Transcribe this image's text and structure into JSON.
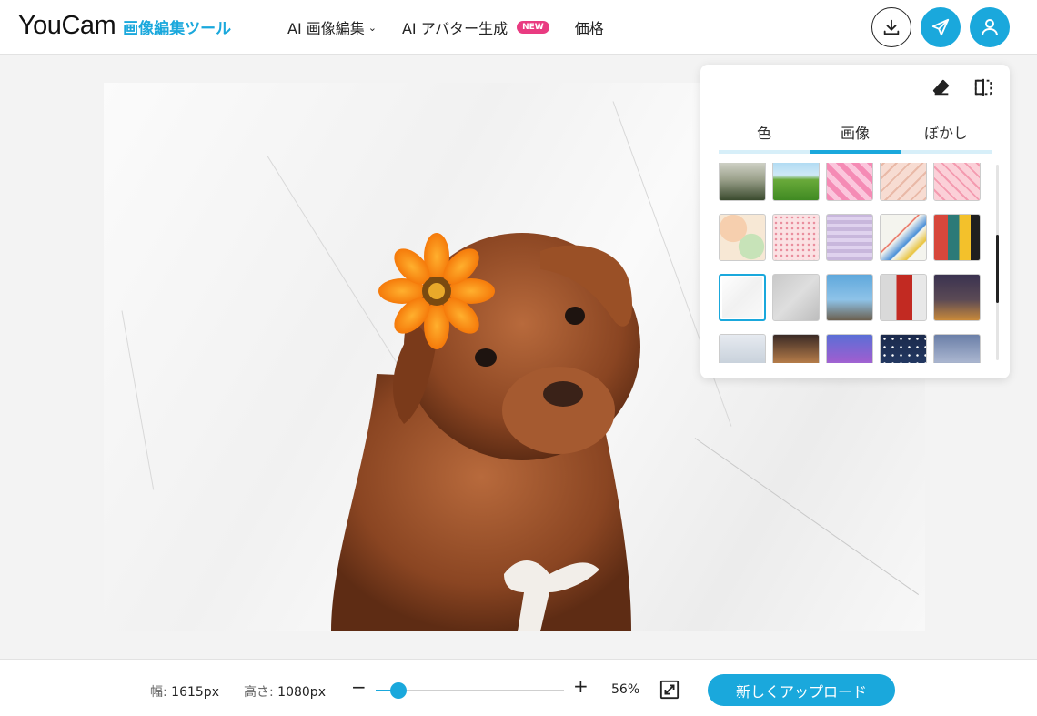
{
  "header": {
    "logo_main": "YouCam",
    "logo_sub": "画像編集ツール",
    "nav": [
      {
        "label": "AI 画像編集",
        "has_dropdown": true
      },
      {
        "label": "AI アバター生成",
        "badge": "NEW"
      },
      {
        "label": "価格"
      }
    ],
    "icons": [
      "download-icon",
      "send-icon",
      "user-icon"
    ]
  },
  "panel": {
    "tabs": [
      {
        "label": "色",
        "active": false
      },
      {
        "label": "画像",
        "active": true
      },
      {
        "label": "ぼかし",
        "active": false
      }
    ],
    "tool_icons": [
      "eraser-icon",
      "compare-icon"
    ],
    "thumbnails": [
      {
        "name": "palm-leaves",
        "fill": "linear-gradient(180deg,#e8e8e2 0%,#9aa08a 55%,#3a4a2e 100%)"
      },
      {
        "name": "green-field",
        "fill": "linear-gradient(180deg,#9fd3f0 0%,#cfe9f7 45%,#6aaa3a 55%,#3f8a22 100%)"
      },
      {
        "name": "pink-hearts",
        "fill": "repeating-linear-gradient(45deg,#f58bb5 0 6px,#fbc6dc 6px 12px)"
      },
      {
        "name": "pink-pattern",
        "fill": "repeating-linear-gradient(135deg,#f7dcd2 0 8px,#e9b9a7 8px 10px)"
      },
      {
        "name": "love-pattern",
        "fill": "repeating-linear-gradient(45deg,#fbd0d8 0 7px,#f49bb0 7px 9px)"
      },
      {
        "name": "pastel-camo",
        "fill": "radial-gradient(circle at 30% 30%,#f6cfae 0 30%,transparent 31%),radial-gradient(circle at 70% 70%,#c7e3b8 0 28%,transparent 29%),#f7e8d5"
      },
      {
        "name": "pink-dots",
        "fill": "radial-gradient(#e98c9c 1px,transparent 1.5px) 0 0/6px 6px,#fbe1e3"
      },
      {
        "name": "lavender-grid",
        "fill": "repeating-linear-gradient(0deg,#c8b7dc 0 4px,#dfd2ee 4px 8px)"
      },
      {
        "name": "color-lines",
        "fill": "linear-gradient(135deg,#f4f4ee 0%,#f4f4ee 40%,#e8614f 42%,#f4f4ee 44%,#4a8fd8 60%,#f4f4ee 62%,#e9c43f 78%,#f4f4ee 80%)"
      },
      {
        "name": "abstract-art",
        "fill": "linear-gradient(90deg,#d7473b 0 30%,#2c7a78 30% 55%,#f3c12b 55% 80%,#1f1f1f 80%)"
      },
      {
        "name": "white-marble",
        "fill": "linear-gradient(135deg,#ffffff 0%,#f1f1f1 50%,#fafafa 100%)"
      },
      {
        "name": "gray-concrete",
        "fill": "linear-gradient(135deg,#c9c9c9 0%,#dedede 50%,#bdbdbd 100%)"
      },
      {
        "name": "eiffel-tower",
        "fill": "linear-gradient(180deg,#5fa8dc 0%,#8ec3e8 55%,#6b5f4e 100%)"
      },
      {
        "name": "london-phone-booth",
        "fill": "linear-gradient(90deg,#d9d9d9 0 35%,#c22a22 35% 70%,#e8e8e8 70%)"
      },
      {
        "name": "big-ben-night",
        "fill": "linear-gradient(180deg,#3a3250 0%,#5b4a55 55%,#c98a3a 100%)"
      },
      {
        "name": "ferris-wheel",
        "fill": "linear-gradient(180deg,#e6eaf0 0%,#b7c3cf 100%)"
      },
      {
        "name": "carousel",
        "fill": "linear-gradient(180deg,#3a2a25 0%,#b27a48 60%,#e8c07a 100%)"
      },
      {
        "name": "purple-sunset",
        "fill": "linear-gradient(180deg,#5b6fd6 0%,#9a5fd0 55%,#c88be0 100%)"
      },
      {
        "name": "starry-night",
        "fill": "radial-gradient(#ffffff 1px,transparent 1.5px) 0 0/9px 9px,linear-gradient(180deg,#1b2a4c 0%,#27406e 100%)"
      },
      {
        "name": "palm-sunset",
        "fill": "linear-gradient(180deg,#6b7fa8 0%,#a9b5cf 60%,#2a2a35 100%)"
      }
    ],
    "selected_index": 10,
    "scroll_fraction": 0.55
  },
  "footer": {
    "width_label": "幅:",
    "width_value": "1615px",
    "height_label": "高さ:",
    "height_value": "1080px",
    "zoom_percent": "56%",
    "zoom_fraction": 0.12,
    "upload_label": "新しくアップロード"
  },
  "colors": {
    "accent": "#1aa8dc",
    "badge": "#e93b81"
  }
}
